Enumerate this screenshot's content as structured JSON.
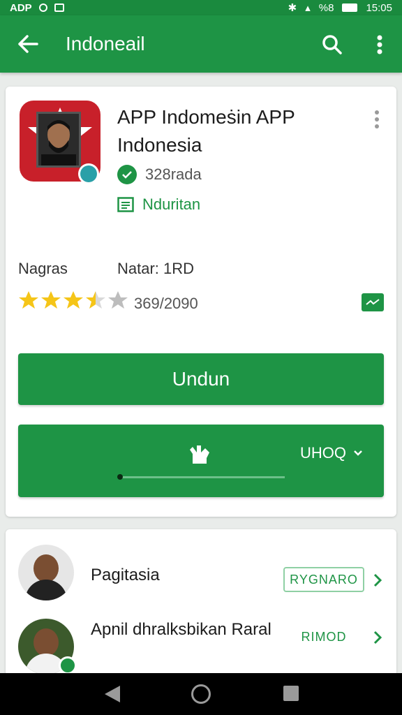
{
  "status_bar": {
    "left_text": "ADP",
    "time": "15:05",
    "battery_text": "%8"
  },
  "app_bar": {
    "title": "Indoneail"
  },
  "app": {
    "name": "APP Indomeṡin APP Indonesia",
    "verified_text": "328rada",
    "developer_text": "Nduritan",
    "label_left": "Nagras",
    "label_right": "Natar: 1RD",
    "rating": 3.5,
    "rating_count": "369/2090",
    "install_label": "Undun",
    "dropdown_label": "UHOQ",
    "progress": 0.0
  },
  "list": {
    "items": [
      {
        "title": "Pagitasia",
        "action": "RYGNARO"
      },
      {
        "title": "Apnil dhralksbikan Raral",
        "action": "RIMOD"
      }
    ]
  },
  "colors": {
    "primary": "#1e9445",
    "status": "#1a8a3e",
    "icon_red": "#c8202a"
  }
}
